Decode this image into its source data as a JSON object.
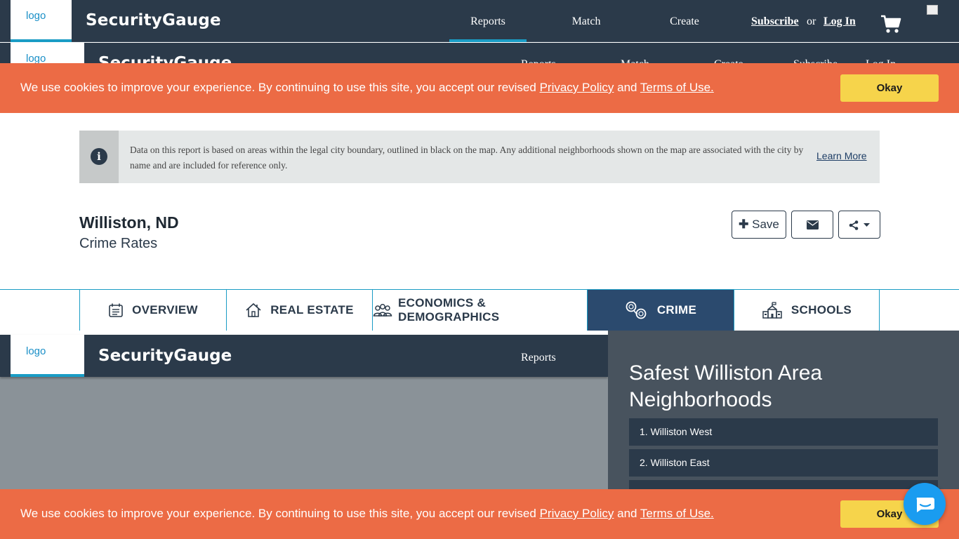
{
  "header": {
    "logo_alt": "logo",
    "brand": "SecurityGauge",
    "nav": {
      "reports": "Reports",
      "match": "Match",
      "create": "Create",
      "subscribe": "Subscribe",
      "or": "or",
      "login": "Log In"
    }
  },
  "cookie": {
    "text": "We use cookies to improve your experience. By continuing to use this site, you accept our revised",
    "privacy": "Privacy Policy",
    "and": "and",
    "terms": "Terms of Use.",
    "okay": "Okay"
  },
  "info": {
    "text": "Data on this report is based on areas within the legal city boundary, outlined in black on the map. Any additional neighborhoods shown on the map are associated with the city by name and are included for reference only.",
    "learn_more": "Learn More"
  },
  "page": {
    "city": "Williston, ND",
    "subtitle": "Crime Rates",
    "save": "Save"
  },
  "tabs": [
    {
      "label": "OVERVIEW",
      "icon": "calendar-icon"
    },
    {
      "label": "REAL ESTATE",
      "icon": "house-icon"
    },
    {
      "label": "ECONOMICS & DEMOGRAPHICS",
      "icon": "people-icon"
    },
    {
      "label": "CRIME",
      "icon": "handcuffs-icon",
      "active": true
    },
    {
      "label": "SCHOOLS",
      "icon": "school-icon"
    }
  ],
  "sidebar": {
    "title": "Safest Williston Area Neighborhoods",
    "items": [
      "1. Williston West",
      "2. Williston East"
    ]
  },
  "colors": {
    "nav_bg": "#2b3a4a",
    "accent": "#1a9cc5",
    "cookie_bg": "#ec6b45",
    "okay_bg": "#f6d44b",
    "active_tab": "#2b4a6e"
  }
}
